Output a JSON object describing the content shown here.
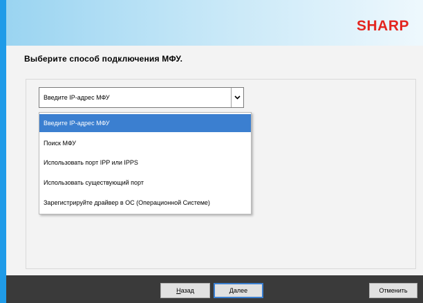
{
  "brand": {
    "logo_text": "SHARP",
    "logo_color": "#e3251f"
  },
  "instruction": "Выберите способ подключения МФУ.",
  "select": {
    "value": "Введите IP-адрес МФУ"
  },
  "options": [
    {
      "label": "Введите IP-адрес МФУ",
      "selected": true
    },
    {
      "label": "Поиск МФУ",
      "selected": false
    },
    {
      "label": "Использовать порт IPP или IPPS",
      "selected": false
    },
    {
      "label": "Использовать существующий порт",
      "selected": false
    },
    {
      "label": "Зарегистрируйте драйвер в ОС (Операционной Системе)",
      "selected": false
    }
  ],
  "buttons": {
    "back": {
      "accel": "Н",
      "rest": "азад"
    },
    "next": {
      "accel": "Д",
      "rest": "алее"
    },
    "cancel": "Отменить"
  },
  "colors": {
    "accent": "#3b7fd0",
    "footer": "#3a3a3a",
    "header_from": "#9ad4f1",
    "header_to": "#eef8fd"
  }
}
